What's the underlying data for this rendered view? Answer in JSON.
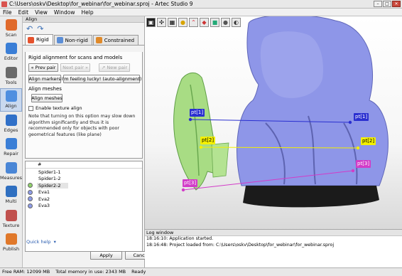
{
  "window": {
    "title": "C:\\Users\\oskv\\Desktop\\for_webinar\\for_webinar.sproj - Artec Studio 9"
  },
  "menu": [
    "File",
    "Edit",
    "View",
    "Window",
    "Help"
  ],
  "toolbar": [
    {
      "label": "Scan",
      "icon": "scan-icon",
      "color": "#e06a2c"
    },
    {
      "label": "Editor",
      "icon": "editor-icon",
      "color": "#3a7ed6"
    },
    {
      "label": "Tools",
      "icon": "tools-icon",
      "color": "#6a6a6a"
    },
    {
      "label": "Align",
      "icon": "align-icon",
      "color": "#4f8fe0",
      "active": true
    },
    {
      "label": "Edges",
      "icon": "edges-icon",
      "color": "#3070c8"
    },
    {
      "label": "Repair",
      "icon": "repair-icon",
      "color": "#3a7ed6"
    },
    {
      "label": "Measures",
      "icon": "measures-icon",
      "color": "#4a86d6"
    },
    {
      "label": "Multi",
      "icon": "multi-icon",
      "color": "#2f6fc0"
    },
    {
      "label": "Texture",
      "icon": "texture-icon",
      "color": "#c0504d"
    },
    {
      "label": "Publish",
      "icon": "publish-icon",
      "color": "#e0782a"
    }
  ],
  "panel": {
    "title": "Align",
    "tabs": [
      {
        "label": "Rigid",
        "color": "#e5522d"
      },
      {
        "label": "Non-rigid",
        "color": "#5b8ed6"
      },
      {
        "label": "Constrained",
        "color": "#e08a2a"
      }
    ],
    "rigid_header": "Rigid alignment for scans and models",
    "prev_pair": "Prev pair",
    "next_pair": "Next pair",
    "new_pair": "New pair",
    "align_markers": "Align markers",
    "feeling_lucky": "I'm feeling lucky! (auto-alignment)",
    "align_meshes_section": "Align meshes",
    "align_meshes_button": "Align meshes",
    "enable_texture": "Enable texture align",
    "note": "Note that turning on this option may slow down algorithm significantly and thus it is recommended only for objects with poor geometrical features (like plane)",
    "list_header": "#",
    "items": [
      {
        "name": "Spider1-1",
        "color": ""
      },
      {
        "name": "Spider1-2",
        "color": ""
      },
      {
        "name": "Spider2-2",
        "color": "#8fd16a",
        "selected": true
      },
      {
        "name": "Eva1",
        "color": "#8e9ce8"
      },
      {
        "name": "Eva2",
        "color": "#8e9ce8"
      },
      {
        "name": "Eva3",
        "color": "#8e9ce8"
      }
    ],
    "quick_help": "Quick help",
    "apply": "Apply",
    "cancel": "Cancel"
  },
  "viewport": {
    "points": [
      {
        "label": "pt[1]",
        "color": "#2a2fd0",
        "text": "#ffffff"
      },
      {
        "label": "pt[2]",
        "color": "#f4f000",
        "text": "#000000"
      },
      {
        "label": "pt[3]",
        "color": "#d23cc8",
        "text": "#ffffff"
      }
    ]
  },
  "log": {
    "title": "Log window",
    "lines": [
      "18:16:10: Application started.",
      "18:16:48: Project loaded from: C:\\Users\\oskv\\Desktop\\for_webinar\\for_webinar.sproj"
    ]
  },
  "status": {
    "free_ram": "Free RAM: 12099 MB",
    "total_memory": "Total memory in use: 2343 MB",
    "state": "Ready"
  }
}
